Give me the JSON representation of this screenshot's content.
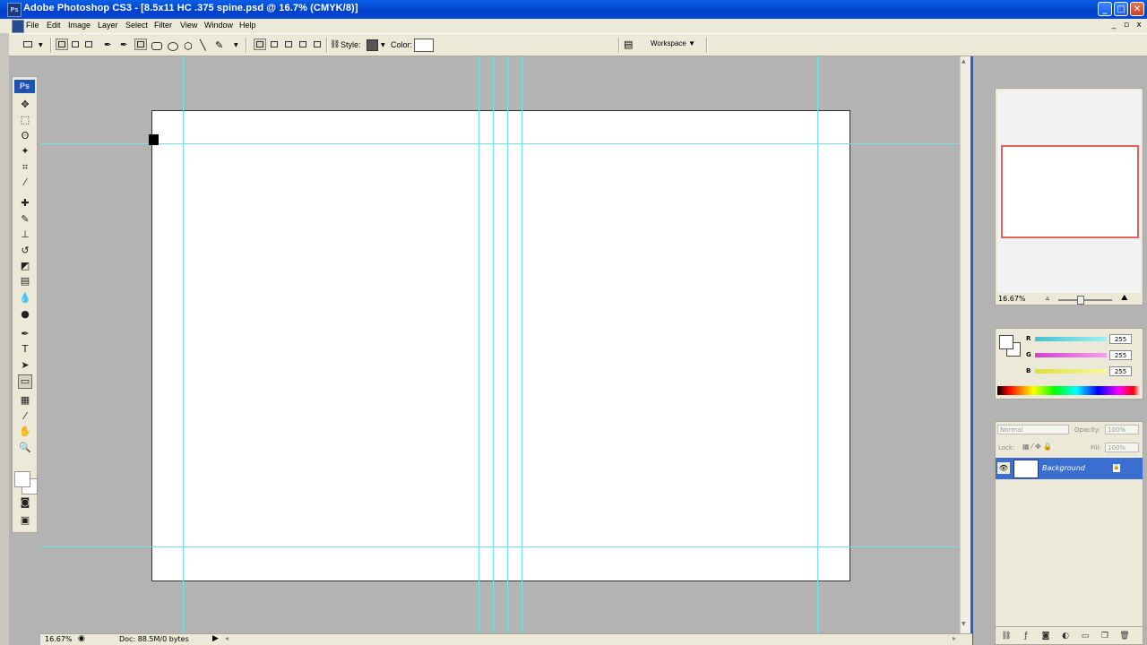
{
  "window": {
    "title": "Adobe Photoshop CS3 - [8.5x11 HC .375 spine.psd @ 16.7% (CMYK/8)]",
    "logo_text": "Ps",
    "controls": {
      "minimize": "_",
      "maximize": "□",
      "close": "✕"
    }
  },
  "menu": {
    "items": [
      "File",
      "Edit",
      "Image",
      "Layer",
      "Select",
      "Filter",
      "View",
      "Window",
      "Help"
    ],
    "mdi_controls": {
      "minimize": "_",
      "restore": "▫",
      "close": "x"
    }
  },
  "options": {
    "style_label": "Style:",
    "color_label": "Color:",
    "workspace_label": "Workspace ▼"
  },
  "toolbox": {
    "badge": "Ps",
    "tools": [
      {
        "icon": "move-icon",
        "glyph": "✥"
      },
      {
        "icon": "marquee-icon",
        "glyph": "⬚"
      },
      {
        "icon": "lasso-icon",
        "glyph": "ʘ"
      },
      {
        "icon": "magic-wand-icon",
        "glyph": "✦"
      },
      {
        "icon": "crop-icon",
        "glyph": "⌗"
      },
      {
        "icon": "slice-icon",
        "glyph": "⁄"
      },
      {
        "icon": "healing-brush-icon",
        "glyph": "✚"
      },
      {
        "icon": "brush-icon",
        "glyph": "✎"
      },
      {
        "icon": "clone-stamp-icon",
        "glyph": "⊥"
      },
      {
        "icon": "history-brush-icon",
        "glyph": "↺"
      },
      {
        "icon": "eraser-icon",
        "glyph": "◩"
      },
      {
        "icon": "gradient-icon",
        "glyph": "▤"
      },
      {
        "icon": "blur-icon",
        "glyph": "💧"
      },
      {
        "icon": "dodge-icon",
        "glyph": "●"
      },
      {
        "icon": "pen-icon",
        "glyph": "✒"
      },
      {
        "icon": "type-icon",
        "glyph": "T"
      },
      {
        "icon": "path-selection-icon",
        "glyph": "➤"
      },
      {
        "icon": "shape-icon",
        "glyph": "▭"
      },
      {
        "icon": "notes-icon",
        "glyph": "▦"
      },
      {
        "icon": "eyedropper-icon",
        "glyph": "⁄"
      },
      {
        "icon": "hand-icon",
        "glyph": "✋"
      },
      {
        "icon": "zoom-icon",
        "glyph": "🔍"
      },
      {
        "icon": "quick-mask-icon",
        "glyph": "◙"
      },
      {
        "icon": "screen-mode-icon",
        "glyph": "▣"
      }
    ]
  },
  "status": {
    "zoom": "16.67%",
    "doc": "Doc: 88.5M/0 bytes"
  },
  "navigator": {
    "zoom": "16.67%"
  },
  "color_panel": {
    "channels": [
      {
        "label": "R",
        "value": "255",
        "color": "#4fd9e6"
      },
      {
        "label": "G",
        "value": "255",
        "color": "#e64fd9"
      },
      {
        "label": "B",
        "value": "255",
        "color": "#e6e64f"
      }
    ]
  },
  "layers_panel": {
    "blend_mode": "Normal",
    "opacity_label": "Opacity:",
    "opacity_value": "100%",
    "lock_label": "Lock:",
    "fill_label": "Fill:",
    "fill_value": "100%",
    "layer_name": "Background"
  },
  "colors": {
    "guide": "#6fe3ea",
    "selection": "#3a6fd1",
    "title_bar": "#0040c8"
  }
}
